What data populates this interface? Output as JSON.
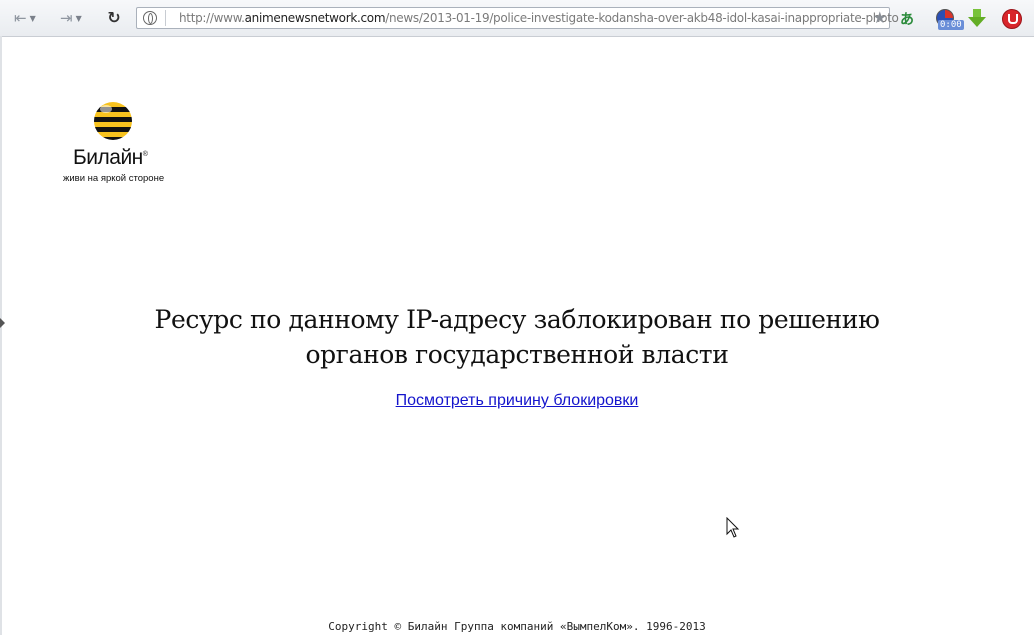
{
  "browser": {
    "url_prefix": "http://www.",
    "url_domain": "animenewsnetwork.com",
    "url_path": "/news/2013-01-19/police-investigate-kodansha-over-akb48-idol-kasai-inappropriate-photo",
    "timer_label": "0:00"
  },
  "page": {
    "logo_name": "Билайн",
    "logo_registered": "®",
    "logo_tagline": "живи на яркой стороне",
    "headline_line1": "Ресурс по данному IP-адресу заблокирован по решению",
    "headline_line2": "органов государственной власти",
    "reason_link": "Посмотреть причину блокировки",
    "copyright": "Copyright © Билайн Группа компаний «ВымпелКом». 1996-2013"
  },
  "icons": {
    "back": "back-icon",
    "forward": "forward-icon",
    "reload": "reload-icon",
    "site_info": "globe-icon",
    "bookmark": "star-icon",
    "translate": "translate-icon",
    "timer": "timer-icon",
    "download": "download-arrow-icon",
    "adblock": "adblock-icon"
  },
  "colors": {
    "link": "#1414cc",
    "logo_yellow": "#f7c21f",
    "logo_black": "#111111"
  }
}
